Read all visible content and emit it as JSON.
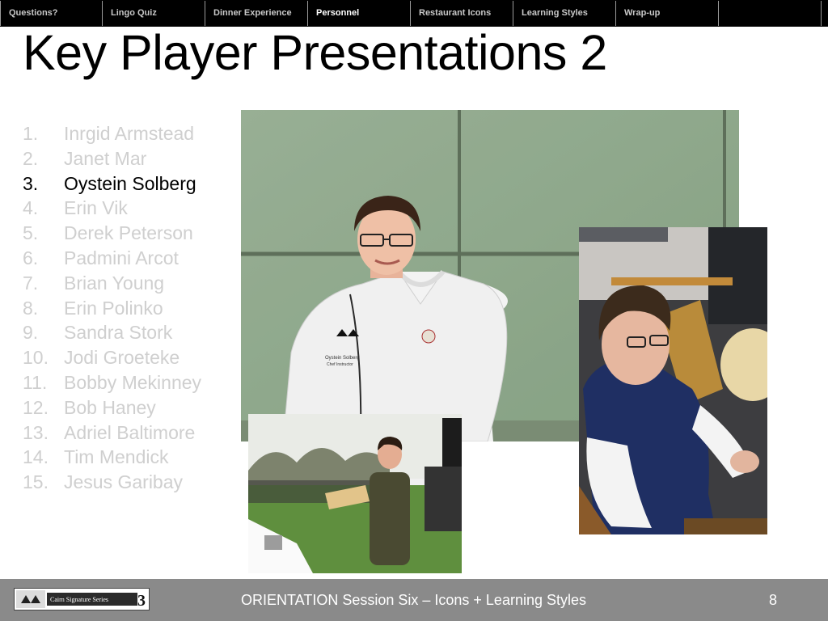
{
  "nav": {
    "tabs": [
      {
        "label": "Questions?"
      },
      {
        "label": "Lingo Quiz"
      },
      {
        "label": "Dinner Experience"
      },
      {
        "label": "Personnel",
        "active": true
      },
      {
        "label": "Restaurant Icons"
      },
      {
        "label": "Learning Styles"
      },
      {
        "label": "Wrap-up"
      },
      {
        "label": ""
      }
    ]
  },
  "slide": {
    "title": "Key Player Presentations 2",
    "people": [
      {
        "num": "1.",
        "name": "Inrgid Armstead"
      },
      {
        "num": "2.",
        "name": "Janet Mar"
      },
      {
        "num": "3.",
        "name": "Oystein Solberg",
        "current": true
      },
      {
        "num": "4.",
        "name": "Erin Vik"
      },
      {
        "num": "5.",
        "name": "Derek Peterson"
      },
      {
        "num": "6.",
        "name": "Padmini Arcot"
      },
      {
        "num": "7.",
        "name": "Brian Young"
      },
      {
        "num": "8.",
        "name": "Erin Polinko"
      },
      {
        "num": "9.",
        "name": "Sandra Stork"
      },
      {
        "num": "10.",
        "name": "Jodi Groeteke"
      },
      {
        "num": "11.",
        "name": "Bobby Mekinney"
      },
      {
        "num": "12.",
        "name": "Bob Haney"
      },
      {
        "num": "13.",
        "name": "Adriel Baltimore"
      },
      {
        "num": "14.",
        "name": "Tim Mendick"
      },
      {
        "num": "15.",
        "name": "Jesus Garibay"
      }
    ],
    "photo_main_coat_text": "Oystein Solberg",
    "photo_main_coat_subtext": "Chef Instructor"
  },
  "footer": {
    "logo_text": "Cairn Signature Series",
    "text": "ORIENTATION Session Six – Icons + Learning Styles",
    "page": "8"
  },
  "colors": {
    "nav_bg": "#000000",
    "nav_text": "#c8c8c8",
    "nav_active": "#ffffff",
    "list_dim": "#cfcfcf",
    "list_current": "#000000",
    "footer_bg": "#8a8a8a"
  }
}
